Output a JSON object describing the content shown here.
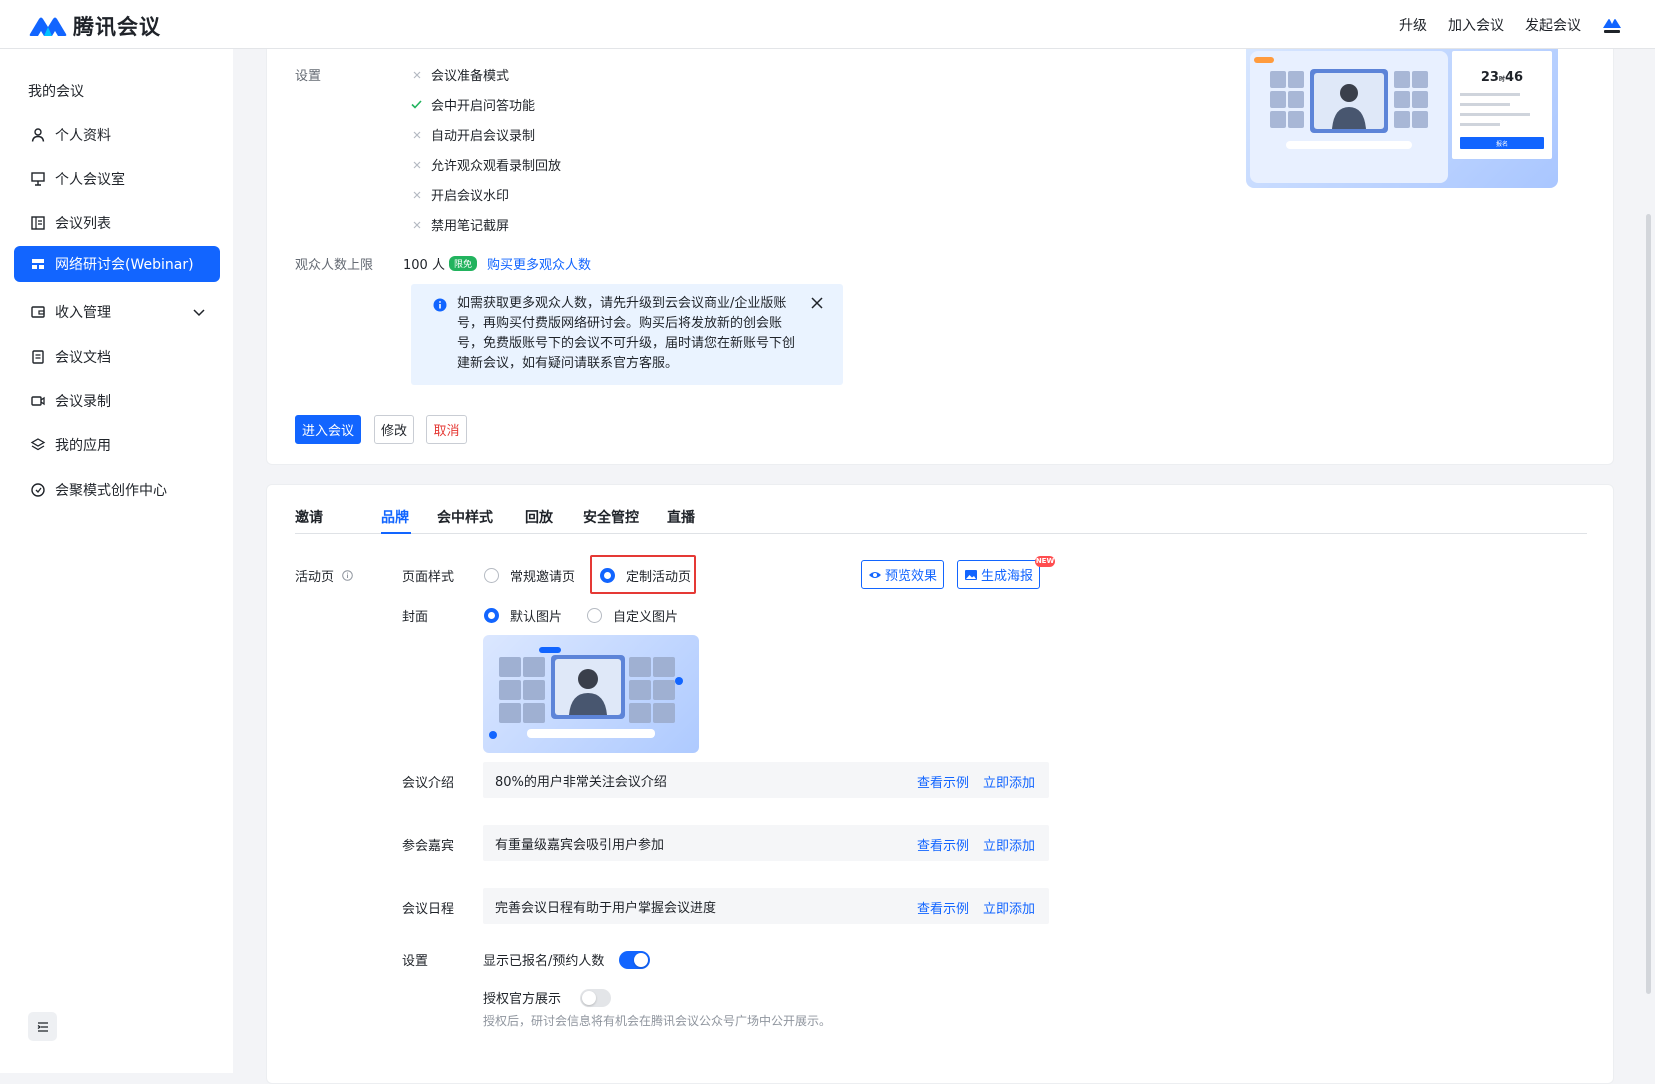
{
  "header": {
    "brand": "腾讯会议",
    "nav": [
      "升级",
      "加入会议",
      "发起会议"
    ],
    "avatar_label": "腾讯会议"
  },
  "sidebar": {
    "heading": "我的会议",
    "items": [
      {
        "label": "个人资料",
        "icon": "user-icon"
      },
      {
        "label": "个人会议室",
        "icon": "monitor-icon"
      },
      {
        "label": "会议列表",
        "icon": "list-icon"
      },
      {
        "label": "网络研讨会(Webinar)",
        "icon": "webinar-icon",
        "active": true
      },
      {
        "label": "收入管理",
        "icon": "wallet-icon"
      },
      {
        "label": "会议文档",
        "icon": "document-icon"
      },
      {
        "label": "会议录制",
        "icon": "camera-icon"
      },
      {
        "label": "我的应用",
        "icon": "layers-icon"
      },
      {
        "label": "会聚模式创作中心",
        "icon": "creation-icon"
      }
    ]
  },
  "meeting": {
    "settings_label": "设置",
    "settings": [
      {
        "label": "会议准备模式",
        "enabled": false
      },
      {
        "label": "会中开启问答功能",
        "enabled": true
      },
      {
        "label": "自动开启会议录制",
        "enabled": false
      },
      {
        "label": "允许观众观看录制回放",
        "enabled": false
      },
      {
        "label": "开启会议水印",
        "enabled": false
      },
      {
        "label": "禁用笔记截屏",
        "enabled": false
      }
    ],
    "audience_label": "观众人数上限",
    "audience_value": "100 人",
    "audience_chip": "限免",
    "buy_link": "购买更多观众人数",
    "notice": "如需获取更多观众人数，请先升级到云会议商业/企业版账号，再购买付费版网络研讨会。购买后将发放新的创会账号，免费版账号下的会议不可升级，届时请您在新账号下创建新会议，如有疑问请联系官方客服。",
    "buttons": {
      "enter": "进入会议",
      "edit": "修改",
      "cancel": "取消"
    }
  },
  "preview": {
    "countdown": "23",
    "countdown_unit": "时",
    "countdown_min": "46",
    "action": "报名"
  },
  "tabs": [
    "邀请",
    "品牌",
    "会中样式",
    "回放",
    "安全管控",
    "直播"
  ],
  "brand": {
    "section_label": "活动页",
    "page_style_label": "页面样式",
    "page_style_options": [
      "常规邀请页",
      "定制活动页"
    ],
    "page_style_selected": 1,
    "preview_button": "预览效果",
    "poster_button": "生成海报",
    "new_badge": "NEW",
    "cover_label": "封面",
    "cover_options": [
      "默认图片",
      "自定义图片"
    ],
    "cover_selected": 0,
    "fields": [
      {
        "label": "会议介绍",
        "placeholder": "80%的用户非常关注会议介绍"
      },
      {
        "label": "参会嘉宾",
        "placeholder": "有重量级嘉宾会吸引用户参加"
      },
      {
        "label": "会议日程",
        "placeholder": "完善会议日程有助于用户掌握会议进度"
      }
    ],
    "field_actions": {
      "example": "查看示例",
      "add": "立即添加"
    },
    "settings_label": "设置",
    "show_count_label": "显示已报名/预约人数",
    "show_count_on": true,
    "authorize_label": "授权官方展示",
    "authorize_on": false,
    "authorize_hint": "授权后，研讨会信息将有机会在腾讯会议公众号广场中公开展示。"
  },
  "colors": {
    "accent": "#1265ff",
    "danger": "#e53935",
    "success": "#22b35e"
  }
}
